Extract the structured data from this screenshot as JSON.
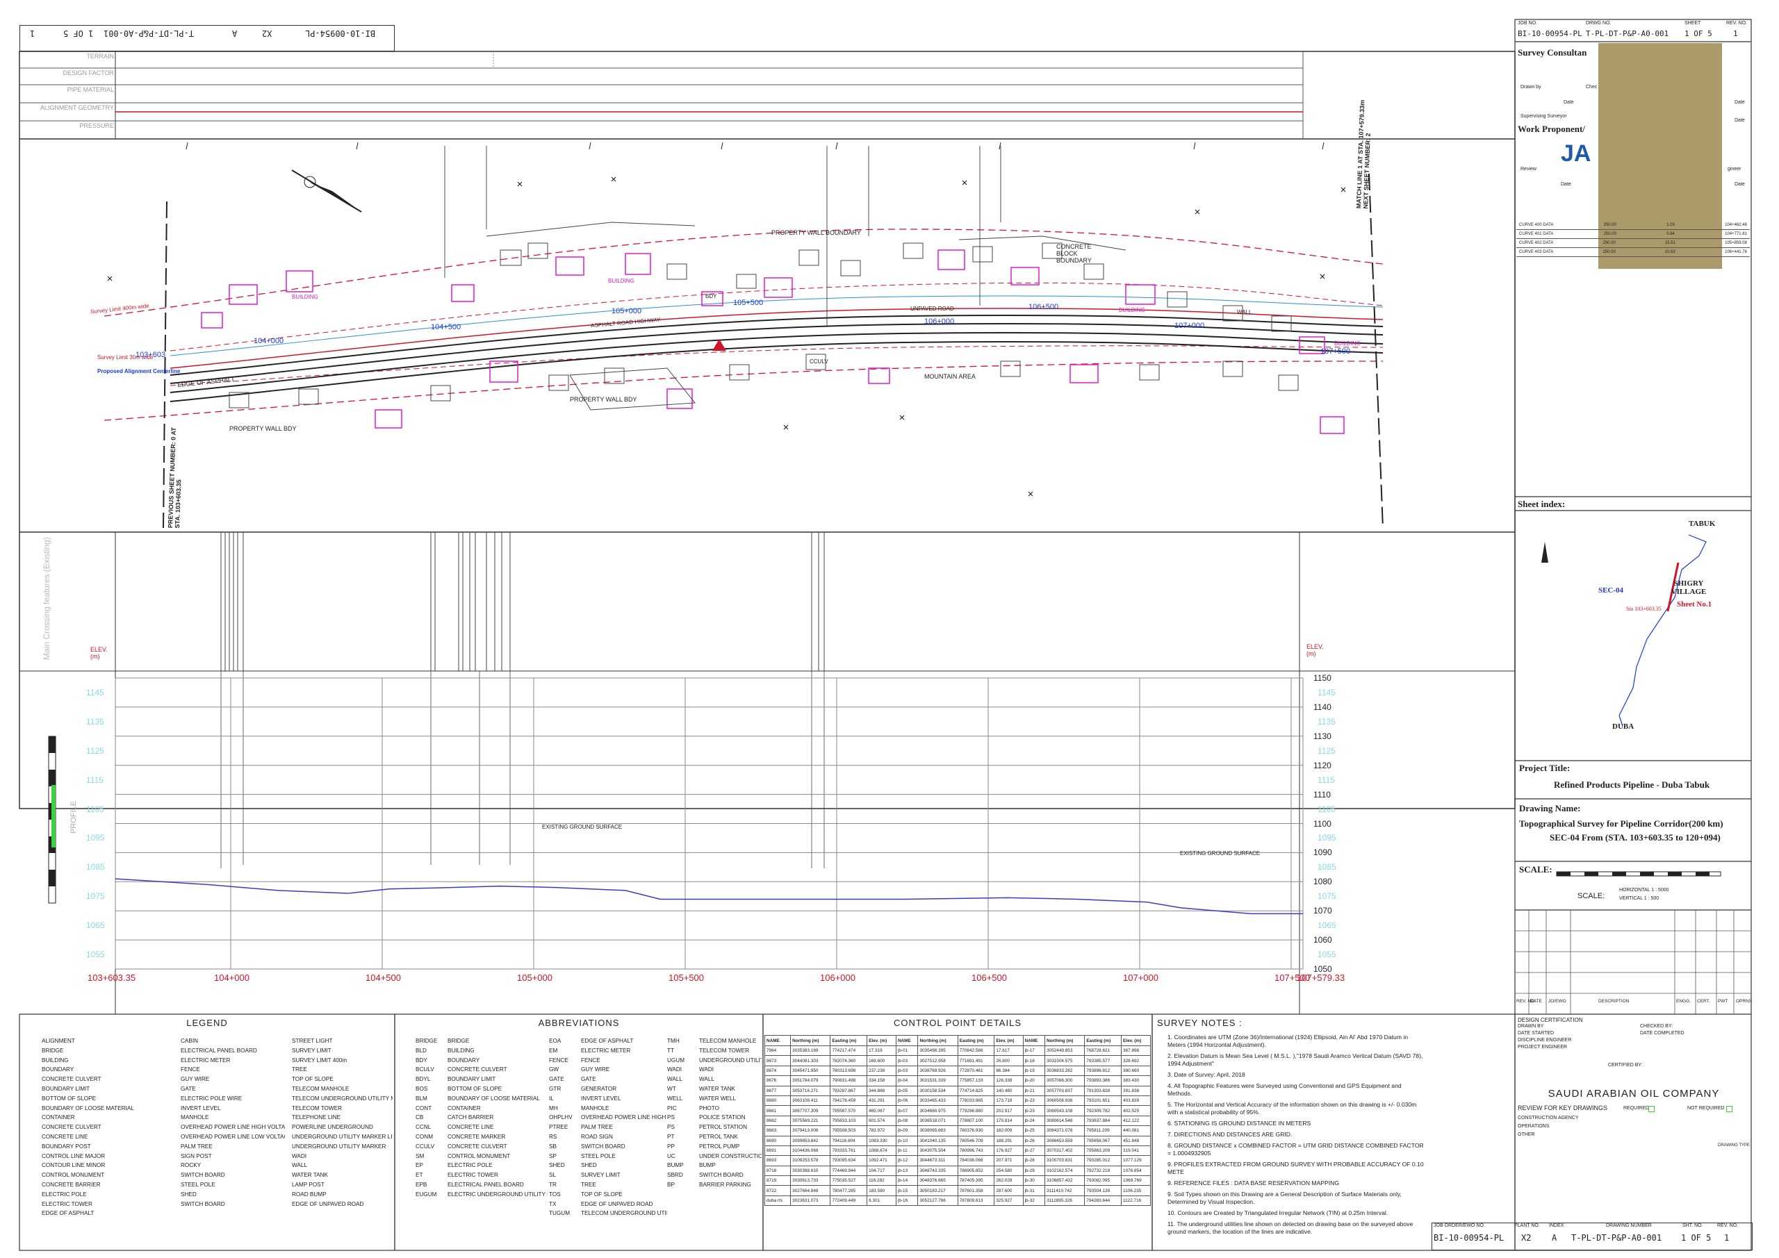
{
  "header": {
    "job_no": "BI-10-00954-PL",
    "plant_no": "X2",
    "index": "A",
    "drawing_number": "T-PL-DT-P&P-A0-001",
    "sheet": "1 OF 5",
    "rev": "1",
    "labels": {
      "job": "JOB ORDER/EWO NO.",
      "plant": "PLANT NO.",
      "index": "INDEX",
      "drawing": "DRAWING NUMBER",
      "sht": "SHT. NO.",
      "rev": "REV. NO."
    }
  },
  "strip_rows": [
    "TERRAIN",
    "DESIGN FACTOR",
    "PIPE MATERIAL",
    "ALIGNMENT GEOMETRY",
    "PRESSURE"
  ],
  "plan": {
    "match_line": "MATCH LINE 1 AT STA. 107+579.33m NEXT SHEET NUMBER: 2",
    "prev_sheet": "PREVIOUS SHEET NUMBER: 0 AT STA. 103+603.35",
    "stations": [
      "103+603",
      "104+000",
      "104+500",
      "105+000",
      "105+500",
      "106+000",
      "106+500",
      "107+000",
      "107+500"
    ],
    "labels": {
      "survey_limit_top": "Survey Limit 400m wide",
      "survey_limit_mid": "Survey Limit 30m wide",
      "alignment": "Proposed Alignment Centerline",
      "edge_asphalt": "EDGE OF ASPHALT",
      "asphalt_road": "ASPHALT ROAD HIGHWAY",
      "property_wall": "PROPERTY WALL BOUNDARY",
      "property_wall_bdy": "PROPERTY WALL BDY",
      "mountain": "MOUNTAIN AREA",
      "concrete_block": "CONCRETE BLOCK BOUNDARY",
      "building": "BUILDING",
      "unpaved": "UNPAVED ROAD",
      "ccuv": "CCULV",
      "wall": "WALL",
      "bdy": "BDY"
    }
  },
  "crossings": {
    "title": "Main Crossing features (Existing)"
  },
  "profile": {
    "elev_label": "ELEV. (m)",
    "ground_label": "EXISTING GROUND SURFACE",
    "side_label": "PROFILE",
    "elevations": [
      "1150",
      "1140",
      "1130",
      "1120",
      "1110",
      "1100",
      "1090",
      "1080",
      "1070",
      "1060",
      "1050"
    ],
    "ghost_elevations": [
      "1145",
      "1135",
      "1125",
      "1115",
      "1105",
      "1095",
      "1085",
      "1075",
      "1065",
      "1055"
    ],
    "stations": [
      "103+603.35",
      "104+000",
      "104+500",
      "105+000",
      "105+500",
      "106+000",
      "106+500",
      "107+000",
      "107+500",
      "107+579.33"
    ]
  },
  "legend": {
    "title": "LEGEND",
    "col1": [
      "ALIGNMENT",
      "BRIDGE",
      "BUILDING",
      "BOUNDARY",
      "CONCRETE CULVERT",
      "BOUNDARY LIMIT",
      "BOTTOM OF SLOPE",
      "BOUNDARY OF LOOSE MATERIAL",
      "CONTAINER",
      "CONCRETE CULVERT",
      "CONCRETE LINE",
      "BOUNDARY POST",
      "CONTROL LINE MAJOR",
      "CONTOUR LINE MINOR",
      "CONTROL MONUMENT",
      "CONCRETE BARRIER",
      "ELECTRIC POLE",
      "ELECTRIC TOWER",
      "EDGE OF ASPHALT"
    ],
    "col2": [
      "CABIN",
      "ELECTRICAL PANEL BOARD",
      "ELECTRIC METER",
      "FENCE",
      "GUY WIRE",
      "GATE",
      "ELECTRIC POLE WIRE",
      "INVERT LEVEL",
      "MANHOLE",
      "OVERHEAD POWER LINE HIGH VOLTAGE",
      "OVERHEAD POWER LINE LOW VOLTAGE",
      "PALM TREE",
      "SIGN POST",
      "ROCKY",
      "SWITCH BOARD",
      "STEEL POLE",
      "SHED",
      "SWITCH BOARD"
    ],
    "col3": [
      "STREET LIGHT",
      "SURVEY LIMIT",
      "SURVEY LIMIT 400m",
      "TREE",
      "TOP OF SLOPE",
      "TELECOM MANHOLE",
      "TELECOM UNDERGROUND UTILITY MARKER",
      "TELECOM TOWER",
      "TELEPHONE LINE",
      "POWERLINE UNDERGROUND",
      "UNDERGROUND UTILITY MARKER LINE",
      "UNDERGROUND UTILITY MARKER",
      "WADI",
      "WALL",
      "WATER TANK",
      "LAMP POST",
      "ROAD BUMP",
      "EDGE OF UNPAVED ROAD"
    ]
  },
  "abbreviations": {
    "title": "ABBREVIATIONS",
    "col1": [
      [
        "BRIDGE",
        "BRIDGE"
      ],
      [
        "BLD",
        "BUILDING"
      ],
      [
        "BDY",
        "BOUNDARY"
      ],
      [
        "BCULV",
        "CONCRETE CULVERT"
      ],
      [
        "BDYL",
        "BOUNDARY LIMIT"
      ],
      [
        "BOS",
        "BOTTOM OF SLOPE"
      ],
      [
        "BLM",
        "BOUNDARY OF LOOSE MATERIAL"
      ],
      [
        "CONT",
        "CONTAINER"
      ],
      [
        "CB",
        "CATCH BARRIER"
      ],
      [
        "CCNL",
        "CONCRETE LINE"
      ],
      [
        "CONM",
        "CONCRETE MARKER"
      ],
      [
        "CCULV",
        "CONCRETE CULVERT"
      ],
      [
        "SM",
        "CONTROL MONUMENT"
      ],
      [
        "EP",
        "ELECTRIC POLE"
      ],
      [
        "ET",
        "ELECTRIC TOWER"
      ],
      [
        "EPB",
        "ELECTRICAL PANEL BOARD"
      ],
      [
        "EUGUM",
        "ELECTRIC UNDERGROUND UTILITY MARKER"
      ]
    ],
    "col2": [
      [
        "EOA",
        "EDGE OF ASPHALT"
      ],
      [
        "EM",
        "ELECTRIC METER"
      ],
      [
        "FENCE",
        "FENCE"
      ],
      [
        "GW",
        "GUY WIRE"
      ],
      [
        "GATE",
        "GATE"
      ],
      [
        "GTR",
        "GENERATOR"
      ],
      [
        "IL",
        "INVERT LEVEL"
      ],
      [
        "MH",
        "MANHOLE"
      ],
      [
        "OHPLHV",
        "OVERHEAD POWER LINE HIGH VOLTAGE"
      ],
      [
        "PTREE",
        "PALM TREE"
      ],
      [
        "RS",
        "ROAD SIGN"
      ],
      [
        "SB",
        "SWITCH BOARD"
      ],
      [
        "SP",
        "STEEL POLE"
      ],
      [
        "SHED",
        "SHED"
      ],
      [
        "SL",
        "SURVEY LIMIT"
      ],
      [
        "TR",
        "TREE"
      ],
      [
        "TOS",
        "TOP OF SLOPE"
      ],
      [
        "TX",
        "EDGE OF UNPAVED ROAD"
      ],
      [
        "TUGUM",
        "TELECOM UNDERGROUND UTILITY MARKER"
      ]
    ],
    "col3": [
      [
        "TMH",
        "TELECOM MANHOLE"
      ],
      [
        "TT",
        "TELECOM TOWER"
      ],
      [
        "UGUM",
        "UNDERGROUND UTILITY MARKER"
      ],
      [
        "WADI",
        "WADI"
      ],
      [
        "WALL",
        "WALL"
      ],
      [
        "WT",
        "WATER TANK"
      ],
      [
        "WELL",
        "WATER WELL"
      ],
      [
        "PIC",
        "PHOTO"
      ],
      [
        "PS",
        "POLICE STATION"
      ],
      [
        "PS",
        "PETROL STATION"
      ],
      [
        "PT",
        "PETROL TANK"
      ],
      [
        "PP",
        "PETROL PUMP"
      ],
      [
        "UC",
        "UNDER CONSTRUCTION"
      ],
      [
        "BUMP",
        "BUMP"
      ],
      [
        "SBRD",
        "SWITCH BOARD"
      ],
      [
        "BP",
        "BARRIER PARKING"
      ]
    ]
  },
  "control_points": {
    "title": "CONTROL POINT DETAILS",
    "headers": [
      "NAME",
      "Northing (m)",
      "Easting (m)",
      "Elev. (m)",
      "NAME",
      "Northing (m)",
      "Easting (m)",
      "Elev. (m)",
      "NAME",
      "Northing (m)",
      "Easting (m)",
      "Elev. (m)"
    ],
    "rows": [
      [
        "7964",
        "3035383.169",
        "774217.474",
        "17.319",
        "jb-01",
        "3035498.395",
        "770842.586",
        "17.617",
        "jb-17",
        "3052449.853",
        "768728.621",
        "367.898"
      ],
      [
        "8673",
        "3044081.303",
        "782074.360",
        "169.600",
        "jb-03",
        "3027512.958",
        "771691.491",
        "26.800",
        "jb-18",
        "3031504.575",
        "793385.577",
        "328.692"
      ],
      [
        "8674",
        "3045471.950",
        "780313.698",
        "237.238",
        "jb-03",
        "3038769.926",
        "772870.461",
        "86.384",
        "jb-19",
        "3036833.282",
        "793896.812",
        "380.660"
      ],
      [
        "8676",
        "3051784.079",
        "790831.498",
        "334.158",
        "jb-04",
        "3031531.339",
        "775857.133",
        "126.338",
        "jb-20",
        "3057066.300",
        "793893.386",
        "383.430"
      ],
      [
        "8677",
        "3053716.271",
        "793287.867",
        "344.888",
        "jb-05",
        "3030158.534",
        "774714.825",
        "140.480",
        "jb-21",
        "3057703.837",
        "791303.828",
        "391.838"
      ],
      [
        "8680",
        "3063108.411",
        "794178.459",
        "431.291",
        "jb-06",
        "3033465.433",
        "776033.865",
        "173.719",
        "jb-23",
        "3060508.936",
        "793101.651",
        "403.839"
      ],
      [
        "8681",
        "3067707.309",
        "795587.570",
        "465.067",
        "jb-07",
        "3034660.975",
        "779296.880",
        "202.917",
        "jb-23",
        "3060543.108",
        "792309.782",
        "402.525"
      ],
      [
        "8682",
        "3075569.221",
        "795633.103",
        "601.574",
        "jb-08",
        "3036518.071",
        "778807.100",
        "170.814",
        "jb-24",
        "3080614.548",
        "793637.884",
        "412.122"
      ],
      [
        "8683",
        "3079413.006",
        "795508.503",
        "783.972",
        "jb-09",
        "3038065.683",
        "780376.930",
        "182.009",
        "jb-25",
        "3084371.078",
        "795811.209",
        "440.081"
      ],
      [
        "8690",
        "3099853.842",
        "794116.804",
        "1083.330",
        "jb-10",
        "3041040.135",
        "780546.709",
        "188.291",
        "jb-26",
        "3086453.559",
        "795658.067",
        "451.848"
      ],
      [
        "8691",
        "3104436.068",
        "793333.761",
        "1088.674",
        "jb-11",
        "3043075.504",
        "780996.743",
        "176.927",
        "jb-27",
        "3070317.402",
        "795863.209",
        "319.041"
      ],
      [
        "8693",
        "3109253.578",
        "793095.634",
        "1092.471",
        "jb-12",
        "3044673.311",
        "784036.066",
        "207.971",
        "jb-28",
        "3100703.631",
        "793285.012",
        "1077.129"
      ],
      [
        "8718",
        "3030388.610",
        "774469.944",
        "104.717",
        "jb-13",
        "3048743.335",
        "786905.852",
        "254.580",
        "jb-29",
        "3102162.574",
        "792732.218",
        "1076.854"
      ],
      [
        "8719",
        "3030613.733",
        "775035.527",
        "116.282",
        "jb-14",
        "3048376.665",
        "787405.395",
        "262.029",
        "jb-30",
        "3106857.432",
        "793082.095",
        "1069.769"
      ],
      [
        "8722",
        "3027664.848",
        "780477.285",
        "183.580",
        "jb-15",
        "3050183.217",
        "787601.358",
        "287.600",
        "jb-31",
        "3111410.742",
        "793504.139",
        "1106.235"
      ],
      [
        "duba rts",
        "3023631.073",
        "772409.449",
        "6.301",
        "jb-16",
        "3052127.766",
        "787809.813",
        "325.927",
        "jb-32",
        "3112895.326",
        "794283.644",
        "1122.716"
      ]
    ]
  },
  "survey_notes": {
    "title": "SURVEY NOTES :",
    "items": [
      "1.  Coordinates are UTM (Zone 36)/International (1924) Ellipsoid, Ain Al' Abd 1970 Datum in Meters (1994 Horizontal Adjustment).",
      "2.  Elevation Datum is Mean Sea Level ( M.S.L. ),\"1978 Saudi Aramco Vertical Datum (SAVD 78), 1994 Adjustment\"",
      "3.  Date of Survey: April, 2018",
      "4.  All Topographic Features were Surveyed using Conventional and GPS Equipment and Methods.",
      "5.  The Horizontal and Vertical Accuracy of the information shown on this drawing is +/- 0.030m with a statistical probability of 95%.",
      "6.  STATIONING IS GROUND DISTANCE IN METERS",
      "7.  DIRECTIONS AND DISTANCES ARE GRID.",
      "8.  GROUND DISTANCE x COMBINED FACTOR = UTM GRID DISTANCE     COMBINED FACTOR = 1.0004932905",
      "9.  PROFILES EXTRACTED FROM GROUND SURVEY WITH PROBABLE ACCURACY OF 0.10 METE",
      "9.  REFERENCE FILES : DATA BASE RESERVATION MAPPING",
      "9.  Soil Types shown on this Drawing are a General Description of Surface Materials only, Determined by Visual Inspection.",
      "10. Contours are Created by Triangulated Irregular Network (TIN) at 0.25m Interval.",
      "11. The underground utilities line shown on detected on drawing base on the surveyed above ground markers, the location of the lines are indicative."
    ]
  },
  "titleblock": {
    "job_no_label": "JOB NO.",
    "job_no": "BI-10-00954-PL",
    "drwg_no_label": "DRWG NO.",
    "drwg_no": "T-PL-DT-P&P-A0-001",
    "sheet_label": "SHEET",
    "sheet": "1 OF 5",
    "rev_label": "REV. NO.",
    "rev": "1",
    "survey_consultant": "Survey Consultan",
    "drawn_by": "Drawn by",
    "checked": "Chec",
    "date": "Date",
    "supervising": "Supervising Surveyor",
    "work_proponent": "Work Proponent/",
    "logo": "JA",
    "review": "Review",
    "engineer": "gineer",
    "curve_rows": [
      [
        "CURVE 400 DATA",
        "250.00",
        "1.03",
        "104+462.48"
      ],
      [
        "CURVE 401 DATA",
        "250.00",
        "0.84",
        "104+771.81"
      ],
      [
        "CURVE 402 DATA",
        "250.00",
        "15.51",
        "105+859.08"
      ],
      [
        "CURVE 403 DATA",
        "250.00",
        "10.62",
        "106+441.76"
      ]
    ],
    "sheet_index": "Sheet index:",
    "map_labels": {
      "tabuk": "TABUK",
      "shigry": "SHIGRY VILLAGE",
      "sec": "SEC-04",
      "sheet_no": "Sheet No.1",
      "duba": "DUBA",
      "sta": "Sta 103+603.35"
    },
    "project_title_label": "Project Title:",
    "project_title": "Refined Products Pipeline - Duba Tabuk",
    "drawing_name_label": "Drawing Name:",
    "drawing_name_1": "Topographical Survey for Pipeline Corridor(200 km)",
    "drawing_name_2": "SEC-04 From (STA. 103+603.35 to 120+094)",
    "scale_label": "SCALE:",
    "scale_h": "HORIZONTAL    1 : 5000",
    "scale_v": "VERTICAL      1 : 500",
    "scale_word": "SCALE:",
    "rev_headers": [
      "REV. NO.",
      "DATE",
      "JO/EWO",
      "DESCRIPTION",
      "ENGG.",
      "CERT.",
      "PWT",
      "OPRNS"
    ],
    "design_cert": "DESIGN CERTIFICATION",
    "drawn_by2": "DRAWN BY",
    "date_started": "DATE STARTED",
    "discipline": "DISCIPLINE ENGINEER",
    "project_eng": "PROJECT ENGINEER",
    "checked_by": "CHECKED BY:",
    "date_completed": "DATE COMPLETED",
    "certified_by": "CERTIFIED BY:",
    "company": "SAUDI  ARABIAN  OIL  COMPANY",
    "review_key": "REVIEW FOR KEY DRAWINGS",
    "required": "REQUIRED",
    "not_required": "NOT REQUIRED",
    "construction": "CONSTRUCTION AGENCY",
    "operations": "OPERATIONS",
    "other": "OTHER",
    "drawing_type": "DRAWING TYPE"
  },
  "colors": {
    "profile_line": "#3a3ac8",
    "grid": "#8a8a8a",
    "alignment": "#d0142a",
    "building": "#e11bd1",
    "station": "#1a3ad6",
    "ghost": "#8ad8e8",
    "redact": "#ab9b6a"
  }
}
